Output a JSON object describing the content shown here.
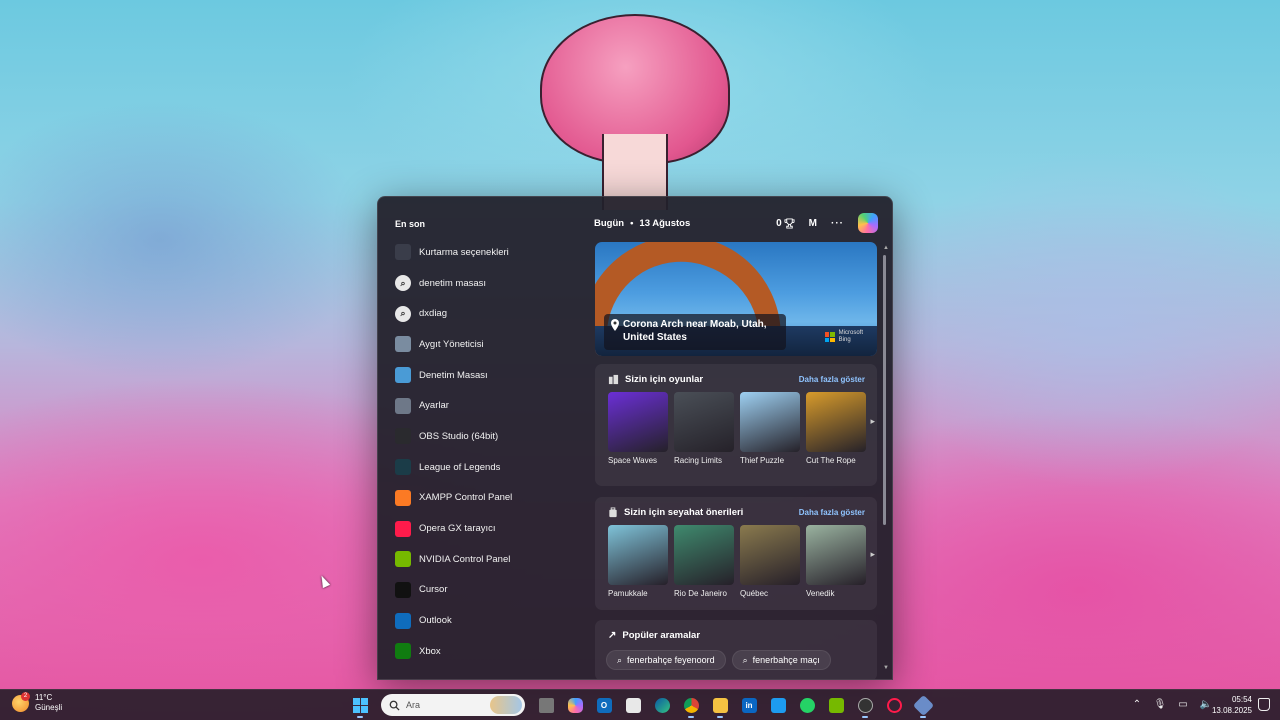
{
  "start_menu": {
    "recent_title": "En son",
    "recent_items": [
      {
        "label": "Kurtarma seçenekleri",
        "icon": "recovery-icon",
        "color": "#3a3d4a"
      },
      {
        "label": "denetim masası",
        "icon": "search-result-icon",
        "color": "#e8e8e8"
      },
      {
        "label": "dxdiag",
        "icon": "search-result-icon",
        "color": "#e8e8e8"
      },
      {
        "label": "Aygıt Yöneticisi",
        "icon": "device-manager-icon",
        "color": "#7a8ca0"
      },
      {
        "label": "Denetim Masası",
        "icon": "control-panel-icon",
        "color": "#4a9bd6"
      },
      {
        "label": "Ayarlar",
        "icon": "settings-icon",
        "color": "#6e7888"
      },
      {
        "label": "OBS Studio (64bit)",
        "icon": "obs-icon",
        "color": "#2a2a2e"
      },
      {
        "label": "League of Legends",
        "icon": "league-icon",
        "color": "#1b3c48"
      },
      {
        "label": "XAMPP Control Panel",
        "icon": "xampp-icon",
        "color": "#fb7a24"
      },
      {
        "label": "Opera GX tarayıcı",
        "icon": "opera-gx-icon",
        "color": "#ff1b4b"
      },
      {
        "label": "NVIDIA Control Panel",
        "icon": "nvidia-icon",
        "color": "#76b900"
      },
      {
        "label": "Cursor",
        "icon": "cursor-app-icon",
        "color": "#111111"
      },
      {
        "label": "Outlook",
        "icon": "outlook-icon",
        "color": "#0f6cbd"
      },
      {
        "label": "Xbox",
        "icon": "xbox-icon",
        "color": "#107c10"
      }
    ]
  },
  "widgets": {
    "today_label": "Bugün",
    "date": "13 Ağustos",
    "rewards_count": "0",
    "account_initial": "M",
    "more_label": "···",
    "hero": {
      "caption": "Corona Arch near Moab, Utah, United States",
      "brand_line1": "Microsoft",
      "brand_line2": "Bing"
    },
    "games": {
      "title": "Sizin için oyunlar",
      "more": "Daha fazla göster",
      "items": [
        {
          "label": "Space Waves",
          "color": "#6b2fd6"
        },
        {
          "label": "Racing Limits",
          "color": "#4a4f57"
        },
        {
          "label": "Thief Puzzle",
          "color": "#9ed0f2"
        },
        {
          "label": "Cut The Rope",
          "color": "#d89b2b"
        }
      ]
    },
    "travel": {
      "title": "Sizin için seyahat önerileri",
      "more": "Daha fazla göster",
      "items": [
        {
          "label": "Pamukkale",
          "color": "#7fc3d9"
        },
        {
          "label": "Rio De Janeiro",
          "color": "#3f8a6e"
        },
        {
          "label": "Québec",
          "color": "#8a7a4e"
        },
        {
          "label": "Venedik",
          "color": "#9ab3a0"
        }
      ]
    },
    "popular": {
      "title": "Popüler aramalar",
      "chips": [
        "fenerbahçe feyenoord",
        "fenerbahçe maçı"
      ]
    }
  },
  "taskbar": {
    "weather": {
      "temp": "11°C",
      "condition": "Güneşli",
      "badge": "2"
    },
    "search_placeholder": "Ara",
    "clock_time": "05:54",
    "clock_date": "13.08.2025"
  }
}
